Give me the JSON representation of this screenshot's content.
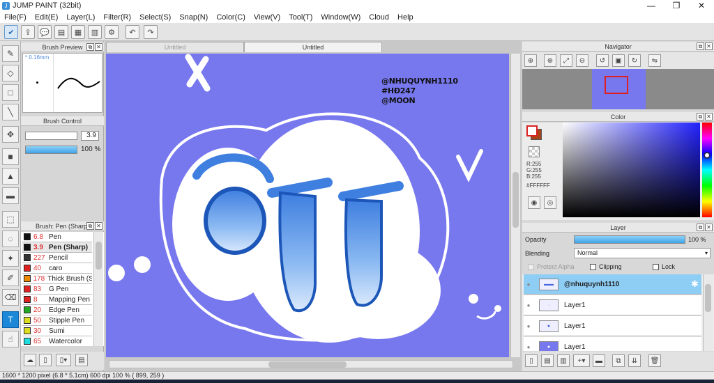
{
  "window": {
    "title": "JUMP PAINT (32bit)",
    "minimize": "—",
    "restore": "❐",
    "close": "✕"
  },
  "menu": [
    "File(F)",
    "Edit(E)",
    "Layer(L)",
    "Filter(R)",
    "Select(S)",
    "Snap(N)",
    "Color(C)",
    "View(V)",
    "Tool(T)",
    "Window(W)",
    "Cloud",
    "Help"
  ],
  "brush_preview": {
    "title": "Brush Preview",
    "size": "* 0.16mm"
  },
  "brush_control": {
    "title": "Brush Control",
    "size_value": "3.9",
    "opacity_value": "100 %",
    "opacity_fraction": 1.0
  },
  "brush_list": {
    "title": "Brush: Pen (Sharp)",
    "items": [
      {
        "size": "6.8",
        "name": "Pen",
        "color": "#111111"
      },
      {
        "size": "3.9",
        "name": "Pen (Sharp)",
        "color": "#111111"
      },
      {
        "size": "227",
        "name": "Pencil",
        "color": "#333333"
      },
      {
        "size": "40",
        "name": "caro",
        "color": "#dd2222"
      },
      {
        "size": "178",
        "name": "Thick Brush (Sl",
        "color": "#ee8800"
      },
      {
        "size": "83",
        "name": "G Pen",
        "color": "#dd2222"
      },
      {
        "size": "8",
        "name": "Mapping Pen",
        "color": "#dd2222"
      },
      {
        "size": "20",
        "name": "Edge Pen",
        "color": "#22aa22"
      },
      {
        "size": "50",
        "name": "Stipple Pen",
        "color": "#dddd22"
      },
      {
        "size": "30",
        "name": "Sumi",
        "color": "#dddd22"
      },
      {
        "size": "65",
        "name": "Watercolor",
        "color": "#22dddd"
      }
    ]
  },
  "tabs": [
    "Untitled",
    "Untitled"
  ],
  "canvas": {
    "watermark_1": "@NHUQUYNH1110",
    "watermark_2": "#HĐ247",
    "watermark_3": "@MOON",
    "art_letters": "OTT"
  },
  "navigator": {
    "title": "Navigator"
  },
  "color_panel": {
    "title": "Color",
    "r": "R:255",
    "g": "G:255",
    "b": "B:255",
    "hex": "#FFFFFF"
  },
  "layer_panel": {
    "title": "Layer",
    "opacity_label": "Opacity",
    "opacity_value": "100 %",
    "opacity_fraction": 1.0,
    "blending_label": "Blending",
    "blending_value": "Normal",
    "protect_alpha": "Protect Alpha",
    "clipping": "Clipping",
    "lock": "Lock",
    "layers": [
      {
        "name": "@nhuquynh1110",
        "active": true
      },
      {
        "name": "Layer1",
        "active": false
      },
      {
        "name": "Layer1",
        "active": false
      },
      {
        "name": "Layer1",
        "active": false
      }
    ]
  },
  "status": {
    "dimensions": "1600 * 1200 pixel",
    "physical": "(6.8 * 5.1cm)",
    "dpi": "600 dpi",
    "zoom": "100 %",
    "cursor": "( 899, 259 )"
  },
  "colors": {
    "canvas_bg": "#7777ee",
    "layer_active": "#8ecdf4",
    "tool_active": "#1e88d8"
  }
}
